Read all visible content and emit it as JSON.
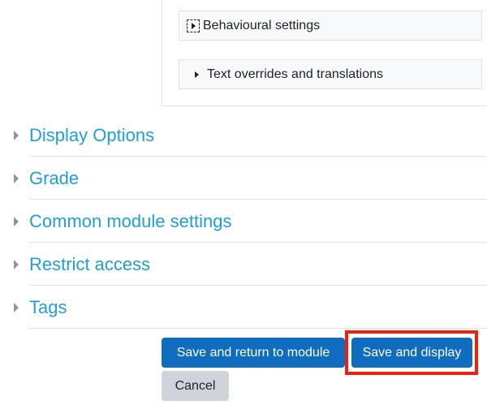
{
  "subsections": [
    {
      "label": "Behavioural settings",
      "icon": "caret-right-focused-icon"
    },
    {
      "label": "Text overrides and translations",
      "icon": "caret-right-icon"
    }
  ],
  "sections": [
    {
      "title": "Display Options",
      "icon": "caret-right-icon"
    },
    {
      "title": "Grade",
      "icon": "caret-right-icon"
    },
    {
      "title": "Common module settings",
      "icon": "caret-right-icon"
    },
    {
      "title": "Restrict access",
      "icon": "caret-right-icon"
    },
    {
      "title": "Tags",
      "icon": "caret-right-icon"
    }
  ],
  "buttons": {
    "save_return": "Save and return to module",
    "save_display": "Save and display",
    "cancel": "Cancel"
  },
  "colors": {
    "primary": "#0f6cbf",
    "section_link": "#1f9fd8",
    "highlight": "#ee2010",
    "secondary": "#ced4da"
  }
}
